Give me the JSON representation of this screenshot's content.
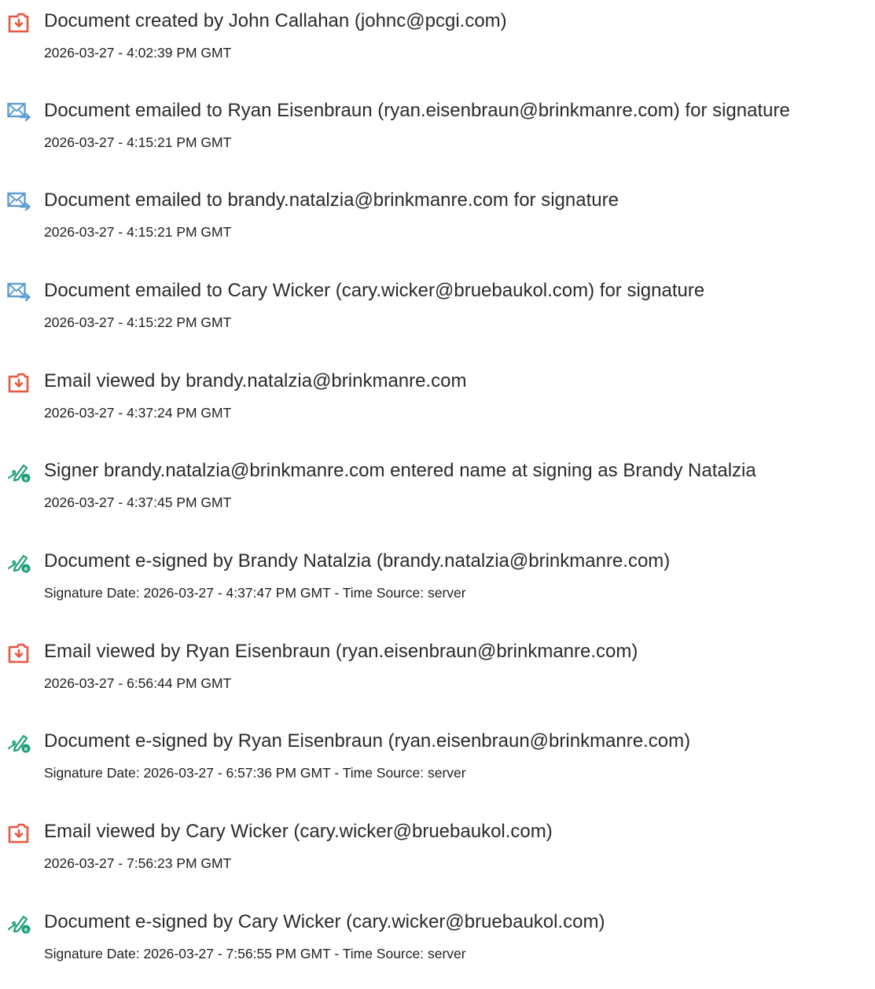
{
  "events": [
    {
      "icon": "document-icon",
      "title": "Document created by John Callahan (johnc@pcgi.com)",
      "timestamp": "2026-03-27 - 4:02:39 PM GMT"
    },
    {
      "icon": "email-sent-icon",
      "title": "Document emailed to Ryan Eisenbraun (ryan.eisenbraun@brinkmanre.com) for signature",
      "timestamp": "2026-03-27 - 4:15:21 PM GMT"
    },
    {
      "icon": "email-sent-icon",
      "title": "Document emailed to brandy.natalzia@brinkmanre.com for signature",
      "timestamp": "2026-03-27 - 4:15:21 PM GMT"
    },
    {
      "icon": "email-sent-icon",
      "title": "Document emailed to Cary Wicker (cary.wicker@bruebaukol.com) for signature",
      "timestamp": "2026-03-27 - 4:15:22 PM GMT"
    },
    {
      "icon": "document-icon",
      "title": "Email viewed by brandy.natalzia@brinkmanre.com",
      "timestamp": "2026-03-27 - 4:37:24 PM GMT"
    },
    {
      "icon": "e-sign-pen-icon",
      "title": "Signer brandy.natalzia@brinkmanre.com entered name at signing as Brandy Natalzia",
      "timestamp": "2026-03-27 - 4:37:45 PM GMT"
    },
    {
      "icon": "e-sign-pen-icon",
      "title": "Document e-signed by Brandy Natalzia (brandy.natalzia@brinkmanre.com)",
      "timestamp": "Signature Date: 2026-03-27 - 4:37:47 PM GMT - Time Source: server"
    },
    {
      "icon": "document-icon",
      "title": "Email viewed by Ryan Eisenbraun (ryan.eisenbraun@brinkmanre.com)",
      "timestamp": "2026-03-27 - 6:56:44 PM GMT"
    },
    {
      "icon": "e-sign-pen-icon",
      "title": "Document e-signed by Ryan Eisenbraun (ryan.eisenbraun@brinkmanre.com)",
      "timestamp": "Signature Date: 2026-03-27 - 6:57:36 PM GMT - Time Source: server"
    },
    {
      "icon": "document-icon",
      "title": "Email viewed by Cary Wicker (cary.wicker@bruebaukol.com)",
      "timestamp": "2026-03-27 - 7:56:23 PM GMT"
    },
    {
      "icon": "e-sign-pen-icon",
      "title": "Document e-signed by Cary Wicker (cary.wicker@bruebaukol.com)",
      "timestamp": "Signature Date: 2026-03-27 - 7:56:55 PM GMT - Time Source: server"
    }
  ],
  "colors": {
    "document_icon": "#e9573f",
    "email_icon": "#5b9bd5",
    "sign_icon": "#1a9e77"
  }
}
